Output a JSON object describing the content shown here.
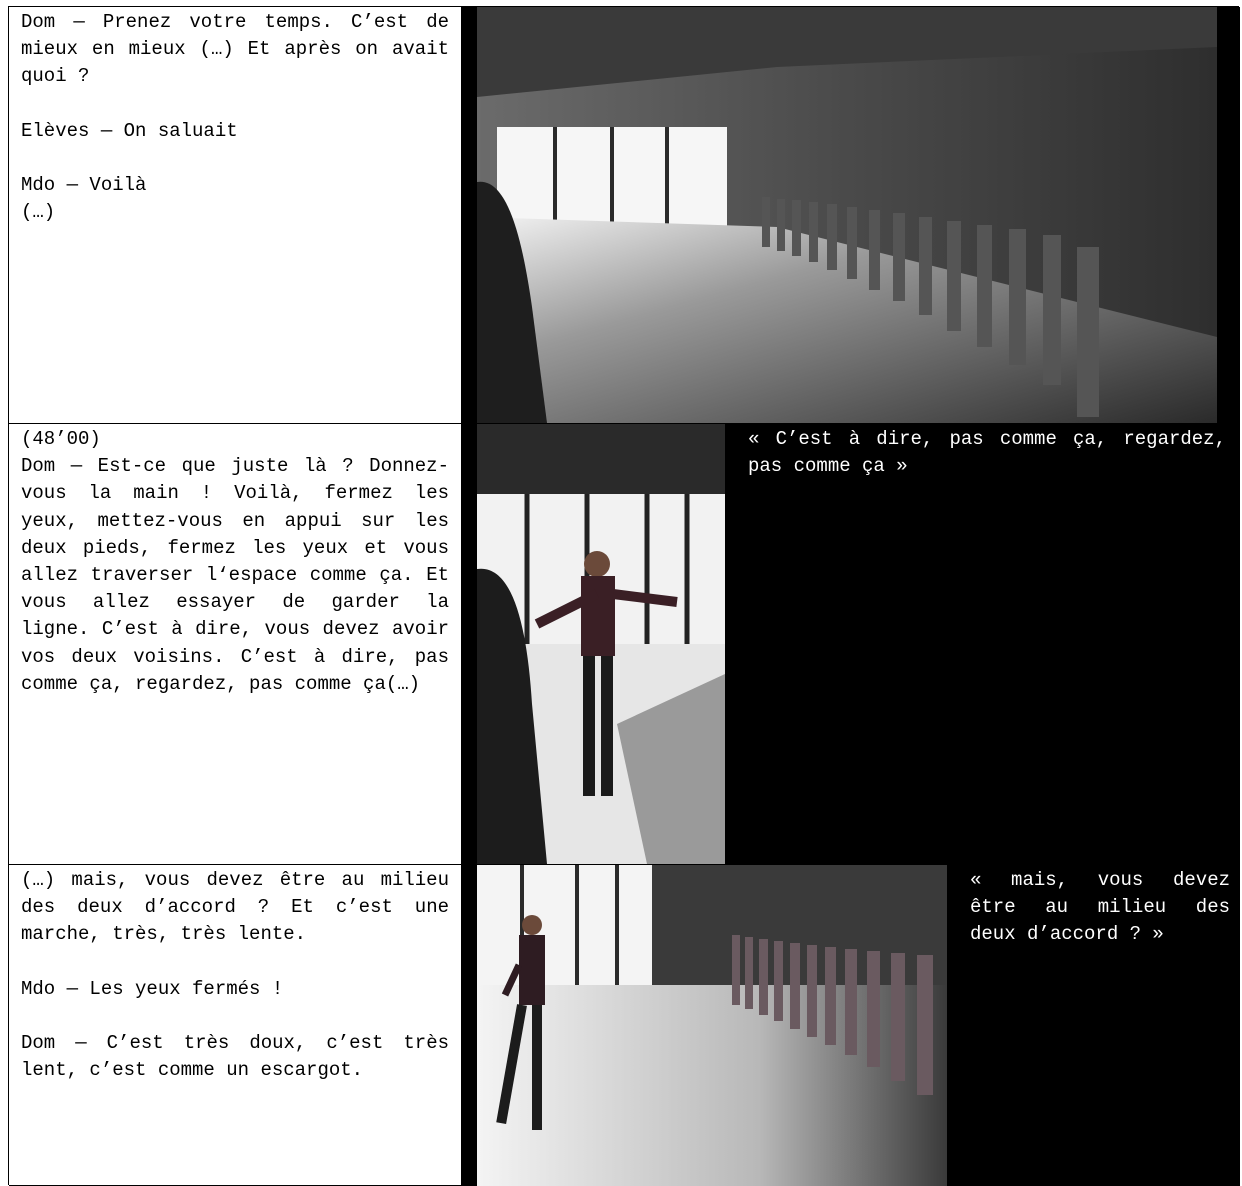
{
  "row1": {
    "text": {
      "p1": "Dom — Prenez votre temps. C’est de mieux en mieux (…) Et après on avait quoi ?",
      "p2": "Elèves — On saluait",
      "p3": "Mdo — Voilà",
      "p4": "(…)"
    },
    "photo": {
      "icon": "photo-dance-studio-children-line"
    }
  },
  "row2": {
    "text": {
      "timestamp": "(48’00)",
      "p1": "Dom — Est-ce que juste là ? Donnez-vous la main ! Voilà, fermez les yeux, mettez-vous en appui sur les deux pieds, fermez les yeux et vous allez traverser l‘espace comme ça. Et vous allez essayer de garder la ligne. C’est à dire, vous devez avoir vos deux voisins. C’est à dire, pas comme ça, regardez, pas comme ça(…)"
    },
    "photo": {
      "icon": "photo-instructor-arms-outstretched"
    },
    "quote": "« C’est à dire, pas comme ça, regardez, pas comme ça »"
  },
  "row3": {
    "text": {
      "p1": "(…) mais,  vous devez être au milieu des deux d’accord ? Et c’est une marche, très, très lente.",
      "p2": "Mdo — Les yeux fermés !",
      "p3": "Dom — C’est très doux, c’est très lent, c’est comme un escargot."
    },
    "photo": {
      "icon": "photo-instructor-and-children-line"
    },
    "quote": "« mais, vous devez être au milieu des deux d’accord ? »"
  },
  "colors": {
    "background": "#ffffff",
    "text": "#000000",
    "quote_text": "#ffffff",
    "panel": "#000000"
  }
}
